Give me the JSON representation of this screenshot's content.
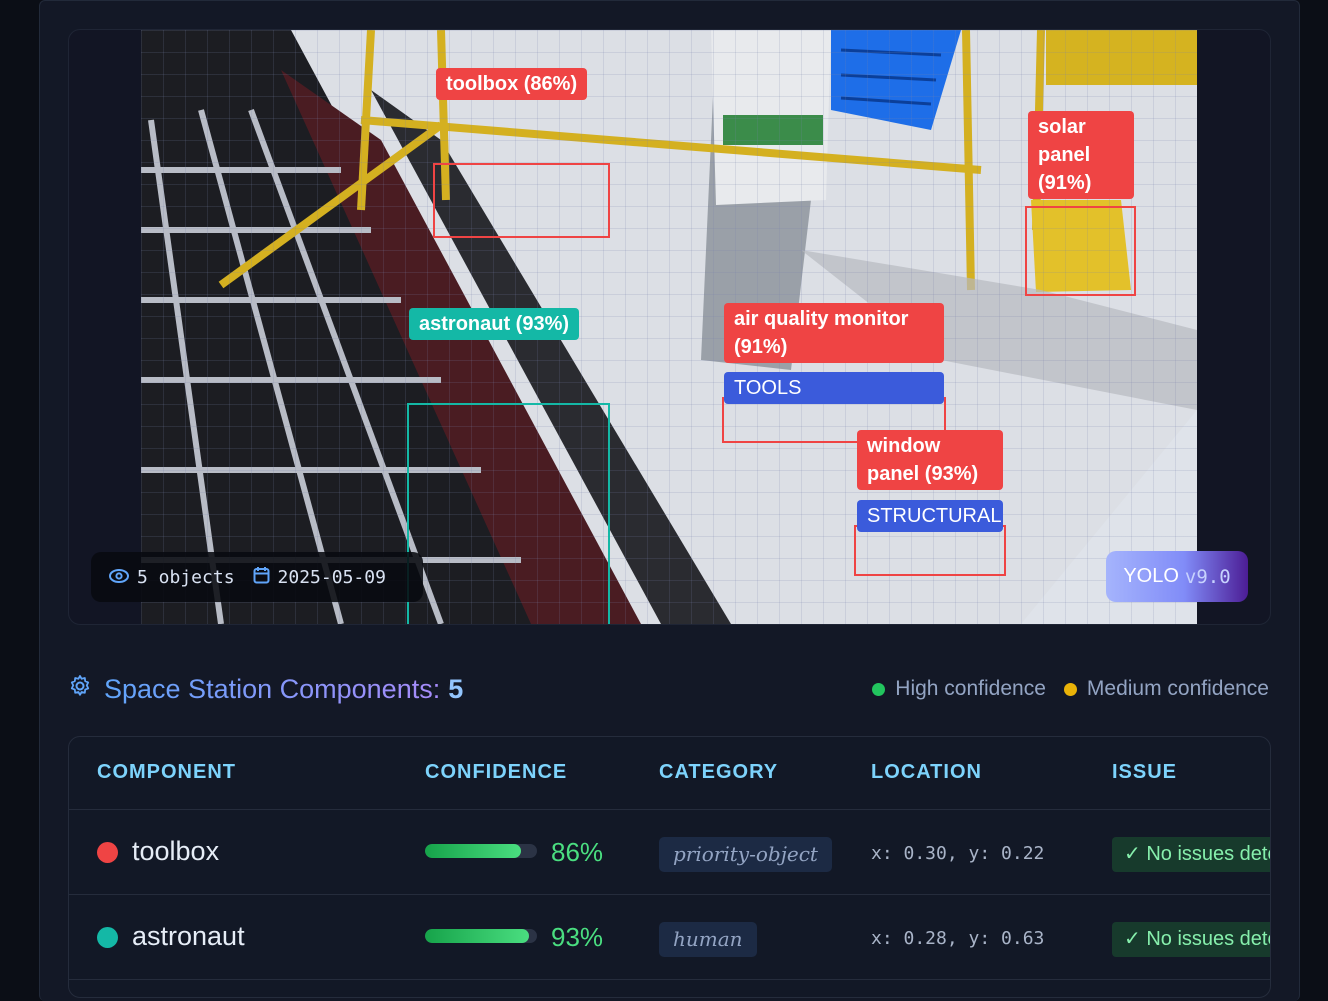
{
  "viewer": {
    "labels": [
      {
        "text": "toolbox (86%)",
        "color": "#ef4444"
      },
      {
        "text": "solar panel (91%)",
        "color": "#ef4444"
      },
      {
        "text": "astronaut (93%)",
        "color": "#14b8a6"
      },
      {
        "text": "air quality monitor (91%)",
        "color": "#ef4444",
        "category": "TOOLS"
      },
      {
        "text": "window panel (93%)",
        "color": "#ef4444",
        "category": "STRUCTURAL"
      }
    ],
    "object_count": "5 objects",
    "date": "2025-05-09",
    "model_name": "YOLO",
    "model_version": "v9.0"
  },
  "section": {
    "title": "Space Station Components:",
    "count": "5",
    "legend": [
      {
        "label": "High confidence",
        "color": "#22c55e"
      },
      {
        "label": "Medium confidence",
        "color": "#eab308"
      }
    ]
  },
  "table": {
    "columns": [
      "COMPONENT",
      "CONFIDENCE",
      "CATEGORY",
      "LOCATION",
      "ISSUE"
    ],
    "rows": [
      {
        "name": "toolbox",
        "dot_color": "#ef4444",
        "confidence": 0.86,
        "confidence_text": "86%",
        "category": "priority-object",
        "location": "x: 0.30, y: 0.22",
        "issue": "✓ No issues detected"
      },
      {
        "name": "astronaut",
        "dot_color": "#14b8a6",
        "confidence": 0.93,
        "confidence_text": "93%",
        "category": "human",
        "location": "x: 0.28, y: 0.63",
        "issue": "✓ No issues detected"
      }
    ]
  }
}
